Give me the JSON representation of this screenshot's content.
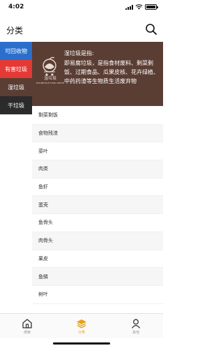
{
  "status_bar": {
    "time": "4:02"
  },
  "header": {
    "title": "分类"
  },
  "categories": [
    {
      "label": "可回收物",
      "bg": "#2a6fcc",
      "fg": "#ffffff"
    },
    {
      "label": "有害垃圾",
      "bg": "#e53935",
      "fg": "#ffffff"
    },
    {
      "label": "湿垃圾",
      "bg": "#5a3d33",
      "fg": "#ffffff"
    },
    {
      "label": "干垃圾",
      "bg": "#2b2b2b",
      "fg": "#ffffff"
    }
  ],
  "banner": {
    "logo_text": "湿垃圾",
    "logo_subtext": "HOUSEHOLD FOOD WASTE",
    "title": "湿垃圾是指:",
    "description": "即易腐垃圾，是指食材废料、剩菜剩饭、过期食品、瓜果皮核、花卉绿植、中药药渣等生物质生活废弃物"
  },
  "items": [
    "剩菜剩饭",
    "食物残渣",
    "菜叶",
    "肉类",
    "鱼虾",
    "蛋壳",
    "鱼骨头",
    "肉骨头",
    "果皮",
    "鱼鳞",
    "树叶"
  ],
  "tabs": [
    {
      "label": "搜索",
      "icon": "home-icon",
      "active": false
    },
    {
      "label": "分类",
      "icon": "layers-icon",
      "active": true
    },
    {
      "label": "其他",
      "icon": "person-icon",
      "active": false
    }
  ],
  "colors": {
    "accent": "#e8a21f",
    "wet_waste": "#5a3d33"
  }
}
